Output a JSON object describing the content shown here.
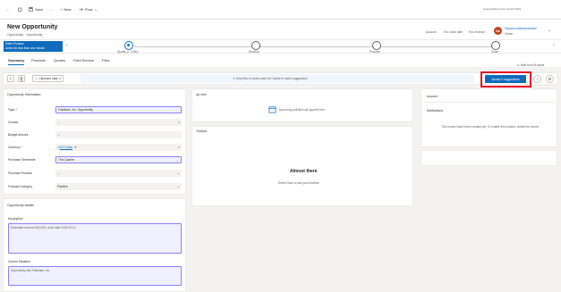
{
  "topbar": {
    "back": "←",
    "save": "Save",
    "more": "…",
    "new": "New",
    "flow": "Flow",
    "right_text": "A generative name record CSIS"
  },
  "header": {
    "title": "New Opportunity",
    "subtitle": "Opportunity · Opportunity ·",
    "account_label": "Account",
    "est_close_label": "Est. close date",
    "est_revenue_label": "Est. revenue",
    "avatar_initials": "SA",
    "owner_name": "System Administrator",
    "owner_role": "Owner"
  },
  "bpf": {
    "flag_line1": "Sales Process",
    "flag_line2": "Active for less than one minute",
    "stages": [
      {
        "label": "Qualify (< 1 Min)",
        "active": true
      },
      {
        "label": "Develop",
        "active": false
      },
      {
        "label": "Propose",
        "active": false
      },
      {
        "label": "Close",
        "active": false
      }
    ]
  },
  "tabs": [
    "Summary",
    "Products",
    "Quotes",
    "Field Service",
    "Files"
  ],
  "hide_fields": "Hide form fill assist",
  "assist_bar": {
    "chip_label": "Clipboard data",
    "drop_text": "Drop files or insert pasts for Copilot to make suggestions",
    "accept_label": "Accept 4 suggestions"
  },
  "opportunity_info": {
    "title": "Opportunity Information",
    "fields": [
      {
        "label": "Topic",
        "required": true,
        "value": "Fabrikam, Inc. Opportunity"
      },
      {
        "label": "Contact",
        "required": false,
        "value": "---"
      },
      {
        "label": "Budget amount",
        "required": false,
        "value": "---"
      },
      {
        "label": "Currency",
        "required": true,
        "value": "US Dollar"
      },
      {
        "label": "Purchase Timeframe",
        "required": false,
        "value": "This Quarter"
      },
      {
        "label": "Purchase Process",
        "required": false,
        "value": "---"
      },
      {
        "label": "Forecast Category",
        "required": false,
        "value": "Pipeline"
      }
    ]
  },
  "opportunity_details": {
    "title": "Opportunity details",
    "description_label": "Description",
    "description_value": "Estimated revenue $10,000; close date 2023-09-22",
    "situation_label": "Current Situation",
    "situation_value": "Opportunity with Fabrikam, Inc."
  },
  "upnext": {
    "title": "Up next",
    "empty_text": "Upcoming activities will appear here"
  },
  "timeline": {
    "title": "Timeline",
    "almost": "Almost there",
    "hint": "Select Save to see your timeline."
  },
  "right_panel": {
    "account": "Account",
    "notifications": "Notifications",
    "notice": "This record hasn't been created yet. To enable this content, create the record."
  }
}
